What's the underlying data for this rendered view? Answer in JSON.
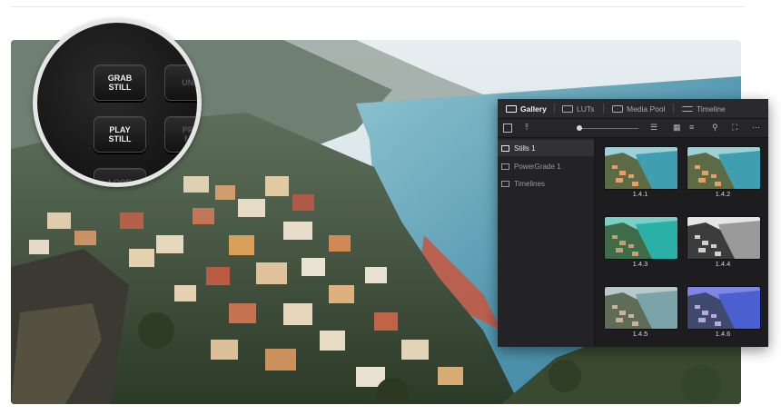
{
  "keyboard": {
    "keys": [
      {
        "label": "GRAB\nSTILL"
      },
      {
        "label": "UND"
      },
      {
        "label": "PLAY\nSTILL"
      },
      {
        "label": "PRE\nME"
      },
      {
        "label": "LOOP"
      }
    ]
  },
  "gallery": {
    "tabs": [
      {
        "label": "Gallery",
        "icon": "gallery-icon"
      },
      {
        "label": "LUTs",
        "icon": "luts-icon"
      },
      {
        "label": "Media Pool",
        "icon": "media-pool-icon"
      },
      {
        "label": "Timeline",
        "icon": "timeline-icon"
      }
    ],
    "albums": [
      {
        "label": "Stills 1"
      },
      {
        "label": "PowerGrade 1"
      },
      {
        "label": "Timelines"
      }
    ],
    "stills": [
      {
        "label": "1.4.1",
        "tone": "warm"
      },
      {
        "label": "1.4.2",
        "tone": "warm"
      },
      {
        "label": "1.4.3",
        "tone": "teal"
      },
      {
        "label": "1.4.4",
        "tone": "mono"
      },
      {
        "label": "1.4.5",
        "tone": "faded"
      },
      {
        "label": "1.4.6",
        "tone": "blue"
      }
    ]
  },
  "colors": {
    "panel_bg": "#222226",
    "sea": "#5b9fb8",
    "sky": "#d7e4e8"
  }
}
